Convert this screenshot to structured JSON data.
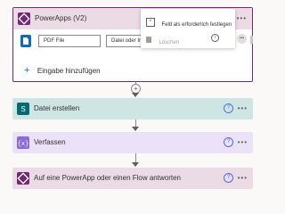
{
  "trigger": {
    "title": "PowerApps (V2)",
    "input_field_name": "PDF File",
    "input_field_description": "Datei oder Image au",
    "add_input_label": "Eingabe hinzufügen",
    "menu_items": [
      {
        "label": "Feld als erforderlich festlegen",
        "icon": "required-field-icon"
      },
      {
        "label": "Löschen",
        "icon": "trash-icon"
      }
    ]
  },
  "actions": [
    {
      "title": "Datei erstellen",
      "color": "#cfe5e4",
      "icon_color": "#036c70",
      "icon": "sharepoint-icon"
    },
    {
      "title": "Verfassen",
      "color": "#ebe1f8",
      "icon_color": "#8a6bd8",
      "icon": "compose-icon"
    },
    {
      "title": "Auf eine PowerApp oder einen Flow antworten",
      "color": "#ebdbe5",
      "icon_color": "#742774",
      "icon": "powerapps-icon"
    }
  ],
  "colors": {
    "accent": "#4f6bed",
    "trigger_border": "#742774",
    "trigger_header": "#ebdbe5"
  }
}
